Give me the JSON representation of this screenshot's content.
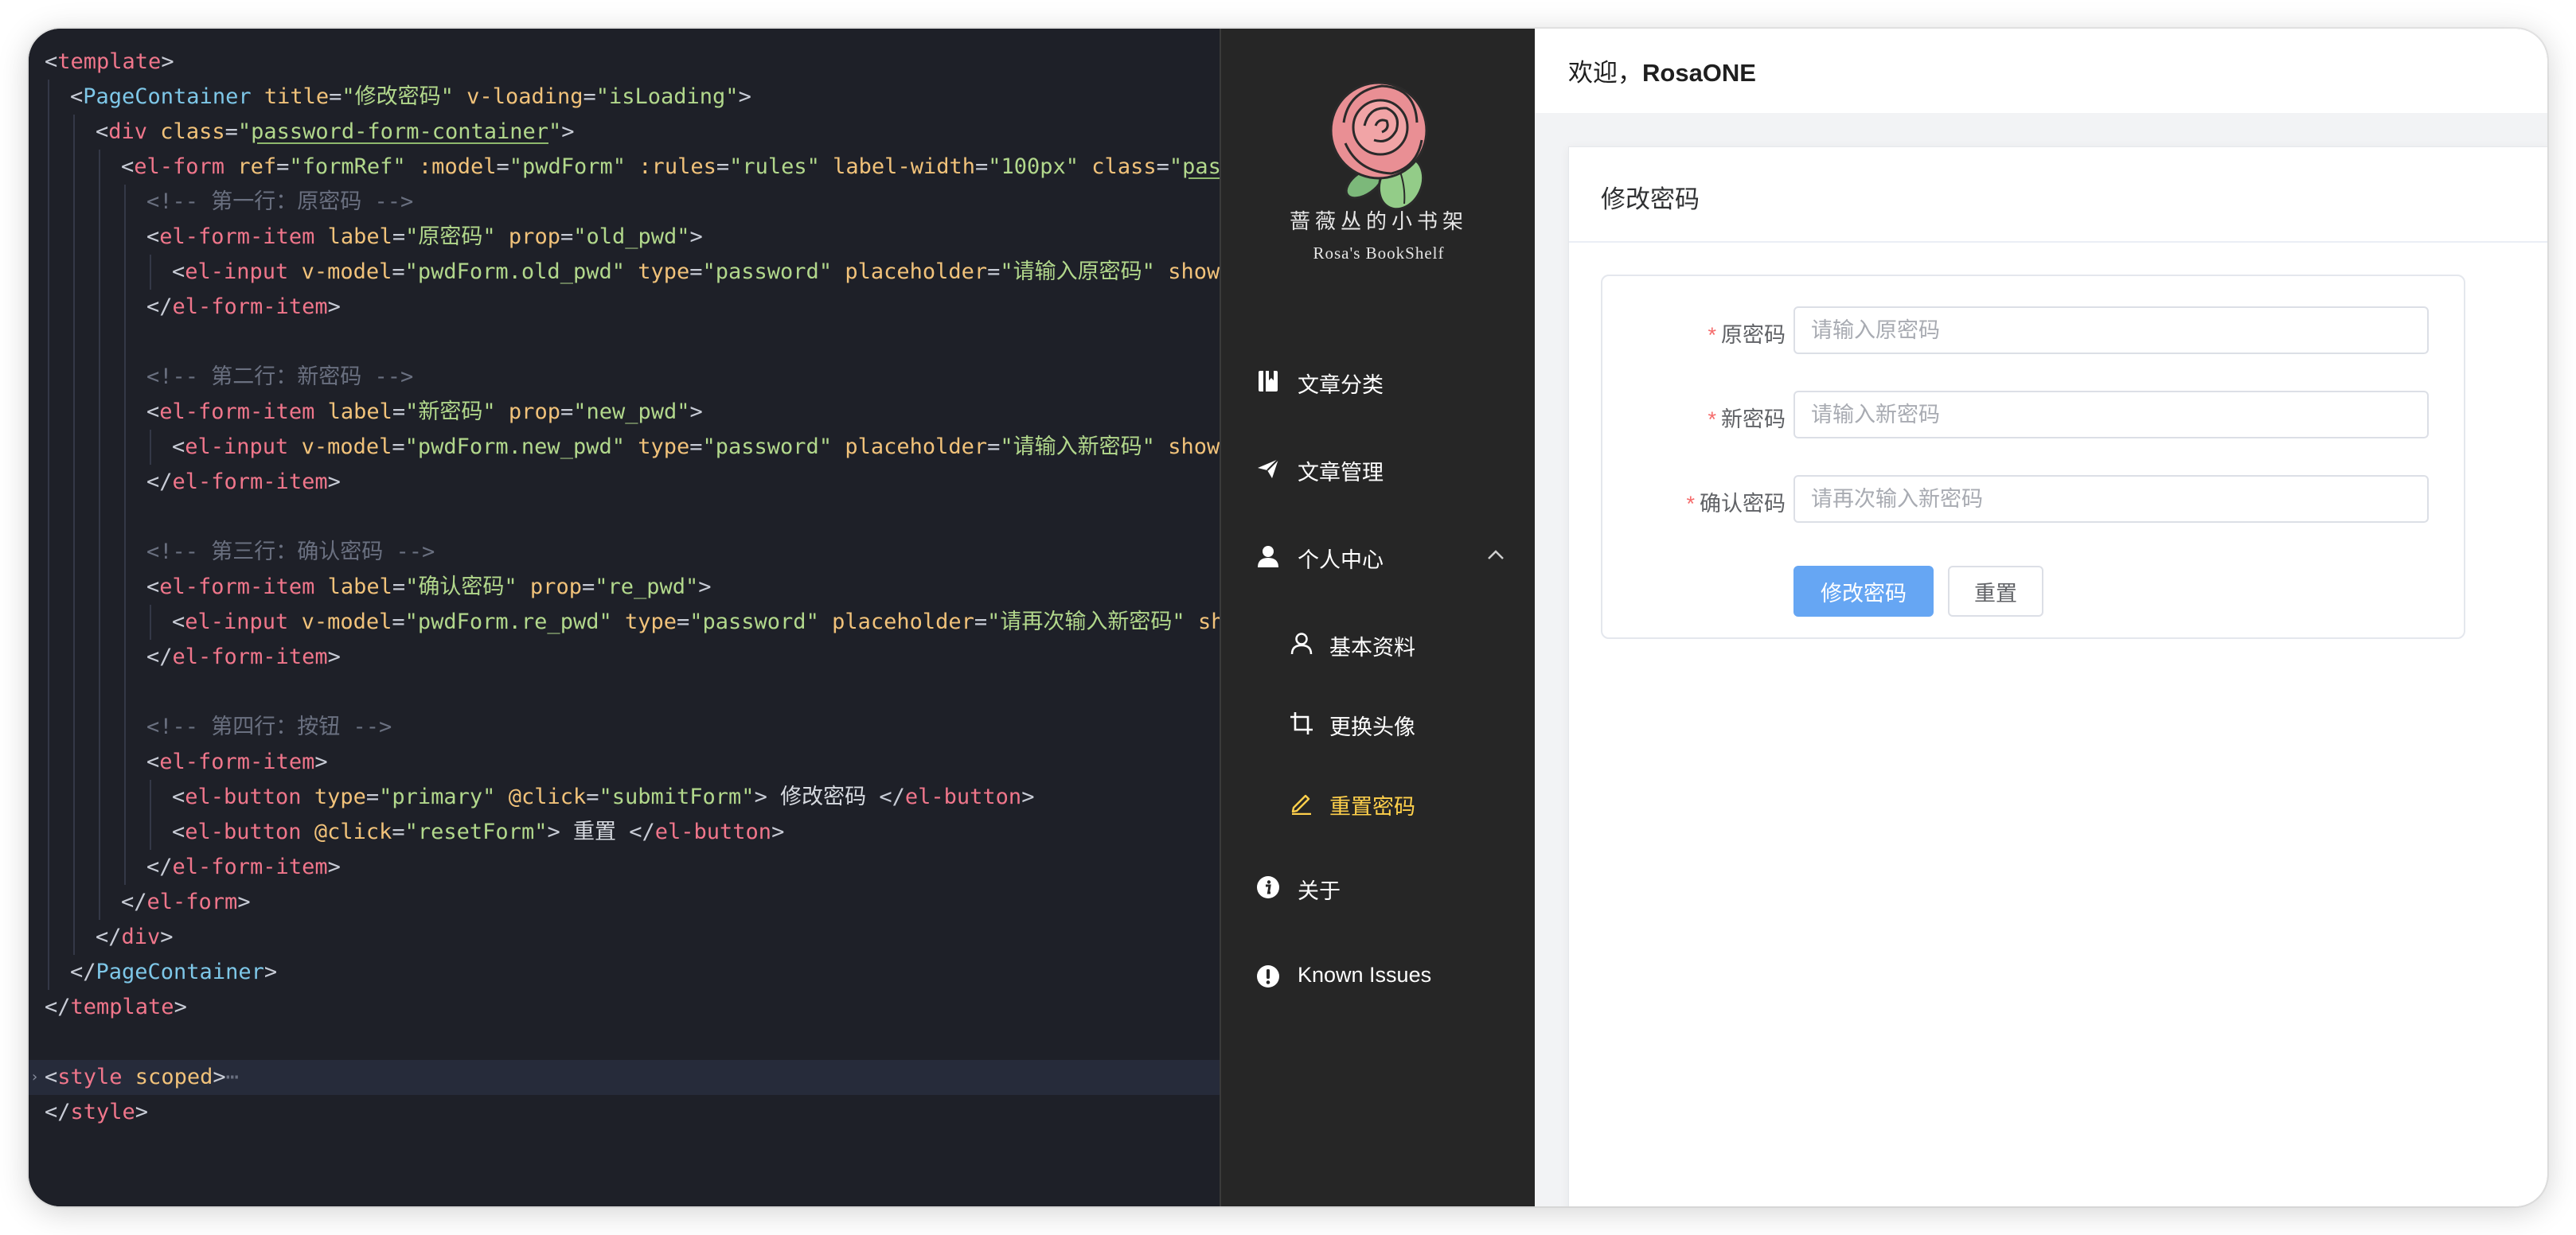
{
  "editor": {
    "lines": [
      {
        "indent": 0,
        "tokens": [
          {
            "t": "<",
            "c": "punct"
          },
          {
            "t": "template",
            "c": "tag"
          },
          {
            "t": ">",
            "c": "punct"
          }
        ]
      },
      {
        "indent": 1,
        "tokens": [
          {
            "t": "<",
            "c": "punct"
          },
          {
            "t": "PageContainer",
            "c": "comp"
          },
          {
            "t": " title",
            "c": "attr"
          },
          {
            "t": "=",
            "c": "punct"
          },
          {
            "t": "\"修改密码\"",
            "c": "str"
          },
          {
            "t": " v-loading",
            "c": "attr"
          },
          {
            "t": "=",
            "c": "punct"
          },
          {
            "t": "\"isLoading\"",
            "c": "str"
          },
          {
            "t": ">",
            "c": "punct"
          }
        ]
      },
      {
        "indent": 2,
        "tokens": [
          {
            "t": "<",
            "c": "punct"
          },
          {
            "t": "div",
            "c": "tag"
          },
          {
            "t": " class",
            "c": "attr"
          },
          {
            "t": "=",
            "c": "punct"
          },
          {
            "t": "\"",
            "c": "str"
          },
          {
            "t": "password-form-container",
            "c": "str ul"
          },
          {
            "t": "\"",
            "c": "str"
          },
          {
            "t": ">",
            "c": "punct"
          }
        ]
      },
      {
        "indent": 3,
        "tokens": [
          {
            "t": "<",
            "c": "punct"
          },
          {
            "t": "el-form",
            "c": "tag"
          },
          {
            "t": " ref",
            "c": "attr"
          },
          {
            "t": "=",
            "c": "punct"
          },
          {
            "t": "\"formRef\"",
            "c": "str"
          },
          {
            "t": " :model",
            "c": "attr"
          },
          {
            "t": "=",
            "c": "punct"
          },
          {
            "t": "\"pwdForm\"",
            "c": "str"
          },
          {
            "t": " :rules",
            "c": "attr"
          },
          {
            "t": "=",
            "c": "punct"
          },
          {
            "t": "\"rules\"",
            "c": "str"
          },
          {
            "t": " label-width",
            "c": "attr"
          },
          {
            "t": "=",
            "c": "punct"
          },
          {
            "t": "\"100px\"",
            "c": "str"
          },
          {
            "t": " class",
            "c": "attr"
          },
          {
            "t": "=",
            "c": "punct"
          },
          {
            "t": "\"",
            "c": "str"
          },
          {
            "t": "pass",
            "c": "str ul"
          }
        ]
      },
      {
        "indent": 4,
        "tokens": [
          {
            "t": "<!-- 第一行：原密码 -->",
            "c": "cmt"
          }
        ]
      },
      {
        "indent": 4,
        "tokens": [
          {
            "t": "<",
            "c": "punct"
          },
          {
            "t": "el-form-item",
            "c": "tag"
          },
          {
            "t": " label",
            "c": "attr"
          },
          {
            "t": "=",
            "c": "punct"
          },
          {
            "t": "\"原密码\"",
            "c": "str"
          },
          {
            "t": " prop",
            "c": "attr"
          },
          {
            "t": "=",
            "c": "punct"
          },
          {
            "t": "\"old_pwd\"",
            "c": "str"
          },
          {
            "t": ">",
            "c": "punct"
          }
        ]
      },
      {
        "indent": 5,
        "tokens": [
          {
            "t": "<",
            "c": "punct"
          },
          {
            "t": "el-input",
            "c": "tag"
          },
          {
            "t": " v-model",
            "c": "attr"
          },
          {
            "t": "=",
            "c": "punct"
          },
          {
            "t": "\"pwdForm.old_pwd\"",
            "c": "str"
          },
          {
            "t": " type",
            "c": "attr"
          },
          {
            "t": "=",
            "c": "punct"
          },
          {
            "t": "\"password\"",
            "c": "str"
          },
          {
            "t": " placeholder",
            "c": "attr"
          },
          {
            "t": "=",
            "c": "punct"
          },
          {
            "t": "\"请输入原密码\"",
            "c": "str"
          },
          {
            "t": " show-p",
            "c": "attr"
          }
        ]
      },
      {
        "indent": 4,
        "tokens": [
          {
            "t": "</",
            "c": "punct"
          },
          {
            "t": "el-form-item",
            "c": "tag"
          },
          {
            "t": ">",
            "c": "punct"
          }
        ]
      },
      {
        "indent": 4,
        "tokens": []
      },
      {
        "indent": 4,
        "tokens": [
          {
            "t": "<!-- 第二行：新密码 -->",
            "c": "cmt"
          }
        ]
      },
      {
        "indent": 4,
        "tokens": [
          {
            "t": "<",
            "c": "punct"
          },
          {
            "t": "el-form-item",
            "c": "tag"
          },
          {
            "t": " label",
            "c": "attr"
          },
          {
            "t": "=",
            "c": "punct"
          },
          {
            "t": "\"新密码\"",
            "c": "str"
          },
          {
            "t": " prop",
            "c": "attr"
          },
          {
            "t": "=",
            "c": "punct"
          },
          {
            "t": "\"new_pwd\"",
            "c": "str"
          },
          {
            "t": ">",
            "c": "punct"
          }
        ]
      },
      {
        "indent": 5,
        "tokens": [
          {
            "t": "<",
            "c": "punct"
          },
          {
            "t": "el-input",
            "c": "tag"
          },
          {
            "t": " v-model",
            "c": "attr"
          },
          {
            "t": "=",
            "c": "punct"
          },
          {
            "t": "\"pwdForm.new_pwd\"",
            "c": "str"
          },
          {
            "t": " type",
            "c": "attr"
          },
          {
            "t": "=",
            "c": "punct"
          },
          {
            "t": "\"password\"",
            "c": "str"
          },
          {
            "t": " placeholder",
            "c": "attr"
          },
          {
            "t": "=",
            "c": "punct"
          },
          {
            "t": "\"请输入新密码\"",
            "c": "str"
          },
          {
            "t": " show-p",
            "c": "attr"
          }
        ]
      },
      {
        "indent": 4,
        "tokens": [
          {
            "t": "</",
            "c": "punct"
          },
          {
            "t": "el-form-item",
            "c": "tag"
          },
          {
            "t": ">",
            "c": "punct"
          }
        ]
      },
      {
        "indent": 4,
        "tokens": []
      },
      {
        "indent": 4,
        "tokens": [
          {
            "t": "<!-- 第三行：确认密码 -->",
            "c": "cmt"
          }
        ]
      },
      {
        "indent": 4,
        "tokens": [
          {
            "t": "<",
            "c": "punct"
          },
          {
            "t": "el-form-item",
            "c": "tag"
          },
          {
            "t": " label",
            "c": "attr"
          },
          {
            "t": "=",
            "c": "punct"
          },
          {
            "t": "\"确认密码\"",
            "c": "str"
          },
          {
            "t": " prop",
            "c": "attr"
          },
          {
            "t": "=",
            "c": "punct"
          },
          {
            "t": "\"re_pwd\"",
            "c": "str"
          },
          {
            "t": ">",
            "c": "punct"
          }
        ]
      },
      {
        "indent": 5,
        "tokens": [
          {
            "t": "<",
            "c": "punct"
          },
          {
            "t": "el-input",
            "c": "tag"
          },
          {
            "t": " v-model",
            "c": "attr"
          },
          {
            "t": "=",
            "c": "punct"
          },
          {
            "t": "\"pwdForm.re_pwd\"",
            "c": "str"
          },
          {
            "t": " type",
            "c": "attr"
          },
          {
            "t": "=",
            "c": "punct"
          },
          {
            "t": "\"password\"",
            "c": "str"
          },
          {
            "t": " placeholder",
            "c": "attr"
          },
          {
            "t": "=",
            "c": "punct"
          },
          {
            "t": "\"请再次输入新密码\"",
            "c": "str"
          },
          {
            "t": " sho",
            "c": "attr"
          }
        ]
      },
      {
        "indent": 4,
        "tokens": [
          {
            "t": "</",
            "c": "punct"
          },
          {
            "t": "el-form-item",
            "c": "tag"
          },
          {
            "t": ">",
            "c": "punct"
          }
        ]
      },
      {
        "indent": 4,
        "tokens": []
      },
      {
        "indent": 4,
        "tokens": [
          {
            "t": "<!-- 第四行：按钮 -->",
            "c": "cmt"
          }
        ]
      },
      {
        "indent": 4,
        "tokens": [
          {
            "t": "<",
            "c": "punct"
          },
          {
            "t": "el-form-item",
            "c": "tag"
          },
          {
            "t": ">",
            "c": "punct"
          }
        ]
      },
      {
        "indent": 5,
        "tokens": [
          {
            "t": "<",
            "c": "punct"
          },
          {
            "t": "el-button",
            "c": "tag"
          },
          {
            "t": " type",
            "c": "attr"
          },
          {
            "t": "=",
            "c": "punct"
          },
          {
            "t": "\"primary\"",
            "c": "str"
          },
          {
            "t": " @click",
            "c": "attr"
          },
          {
            "t": "=",
            "c": "punct"
          },
          {
            "t": "\"submitForm\"",
            "c": "str"
          },
          {
            "t": ">",
            "c": "punct"
          },
          {
            "t": " 修改密码 ",
            "c": "text"
          },
          {
            "t": "</",
            "c": "punct"
          },
          {
            "t": "el-button",
            "c": "tag"
          },
          {
            "t": ">",
            "c": "punct"
          }
        ]
      },
      {
        "indent": 5,
        "tokens": [
          {
            "t": "<",
            "c": "punct"
          },
          {
            "t": "el-button",
            "c": "tag"
          },
          {
            "t": " @click",
            "c": "attr"
          },
          {
            "t": "=",
            "c": "punct"
          },
          {
            "t": "\"resetForm\"",
            "c": "str"
          },
          {
            "t": ">",
            "c": "punct"
          },
          {
            "t": " 重置 ",
            "c": "text"
          },
          {
            "t": "</",
            "c": "punct"
          },
          {
            "t": "el-button",
            "c": "tag"
          },
          {
            "t": ">",
            "c": "punct"
          }
        ]
      },
      {
        "indent": 4,
        "tokens": [
          {
            "t": "</",
            "c": "punct"
          },
          {
            "t": "el-form-item",
            "c": "tag"
          },
          {
            "t": ">",
            "c": "punct"
          }
        ]
      },
      {
        "indent": 3,
        "tokens": [
          {
            "t": "</",
            "c": "punct"
          },
          {
            "t": "el-form",
            "c": "tag"
          },
          {
            "t": ">",
            "c": "punct"
          }
        ]
      },
      {
        "indent": 2,
        "tokens": [
          {
            "t": "</",
            "c": "punct"
          },
          {
            "t": "div",
            "c": "tag"
          },
          {
            "t": ">",
            "c": "punct"
          }
        ]
      },
      {
        "indent": 1,
        "tokens": [
          {
            "t": "</",
            "c": "punct"
          },
          {
            "t": "PageContainer",
            "c": "comp"
          },
          {
            "t": ">",
            "c": "punct"
          }
        ]
      },
      {
        "indent": 0,
        "tokens": [
          {
            "t": "</",
            "c": "punct"
          },
          {
            "t": "template",
            "c": "tag"
          },
          {
            "t": ">",
            "c": "punct"
          }
        ]
      },
      {
        "indent": 0,
        "tokens": []
      },
      {
        "indent": 0,
        "highlight": true,
        "folded": true,
        "tokens": [
          {
            "t": "<",
            "c": "punct"
          },
          {
            "t": "style",
            "c": "tag"
          },
          {
            "t": " scoped",
            "c": "attr"
          },
          {
            "t": ">",
            "c": "punct"
          },
          {
            "t": "⋯",
            "c": "cmt"
          }
        ]
      },
      {
        "indent": 0,
        "tokens": [
          {
            "t": "</",
            "c": "punct"
          },
          {
            "t": "style",
            "c": "tag"
          },
          {
            "t": ">",
            "c": "punct"
          }
        ]
      }
    ]
  },
  "sidebar": {
    "logo_title": "蔷薇丛的小书架",
    "logo_subtitle": "Rosa's BookShelf",
    "menu": [
      {
        "label": "文章分类",
        "icon": "book-icon"
      },
      {
        "label": "文章管理",
        "icon": "paper-plane-icon"
      },
      {
        "label": "个人中心",
        "icon": "user-icon",
        "expanded": true
      },
      {
        "label": "基本资料",
        "icon": "user-outline-icon",
        "sub": true
      },
      {
        "label": "更换头像",
        "icon": "crop-icon",
        "sub": true
      },
      {
        "label": "重置密码",
        "icon": "edit-pen-icon",
        "sub": true,
        "active": true
      },
      {
        "label": "关于",
        "icon": "info-circle-icon"
      },
      {
        "label": "Known Issues",
        "icon": "warning-circle-icon"
      }
    ]
  },
  "header": {
    "welcome_prefix": "欢迎，",
    "username": "RosaONE"
  },
  "page": {
    "title": "修改密码",
    "form": {
      "old_pwd": {
        "label": "原密码",
        "placeholder": "请输入原密码",
        "value": ""
      },
      "new_pwd": {
        "label": "新密码",
        "placeholder": "请输入新密码",
        "value": ""
      },
      "re_pwd": {
        "label": "确认密码",
        "placeholder": "请再次输入新密码",
        "value": ""
      },
      "submit_label": "修改密码",
      "reset_label": "重置",
      "required_mark": "*"
    }
  },
  "colors": {
    "sidebar_bg": "#262626",
    "menu_active": "#ffd04b",
    "primary_button": "#66a6f3",
    "required_star": "#f56c6c",
    "editor_bg": "#1e2028"
  }
}
